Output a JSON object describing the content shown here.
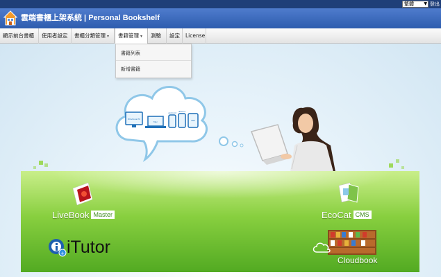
{
  "topbar": {
    "language_value": "繁體",
    "logout_label": "登出"
  },
  "header": {
    "title": "雲端書櫃上架系統 | Personal Bookshelf",
    "logo_icon": "home-icon"
  },
  "nav": {
    "items": [
      {
        "label": "顯示前台書櫃",
        "has_menu": false
      },
      {
        "label": "使用者設定",
        "has_menu": false
      },
      {
        "label": "書櫃分類管理",
        "has_menu": true
      },
      {
        "label": "書籍管理",
        "has_menu": true
      },
      {
        "label": "測驗",
        "has_menu": false
      },
      {
        "label": "設定",
        "has_menu": false
      },
      {
        "label": "License",
        "has_menu": false
      }
    ],
    "active_index": 3
  },
  "dropdown": {
    "items": [
      "書籍列表",
      "新增書籍"
    ]
  },
  "hero": {
    "cloud_devices": [
      "Windows PC",
      "Mac",
      "Android",
      "iPhone",
      "iPad"
    ],
    "products": [
      {
        "name": "LiveBook",
        "badge": "Master"
      },
      {
        "name": "EcoCat",
        "badge": "CMS"
      },
      {
        "name": "iTutor",
        "badge": ""
      },
      {
        "name": "Cloudbook",
        "badge": ""
      }
    ]
  },
  "colors": {
    "topstrip": "#1f3f79",
    "header": "#3a68bd",
    "green": "#6cc230"
  }
}
